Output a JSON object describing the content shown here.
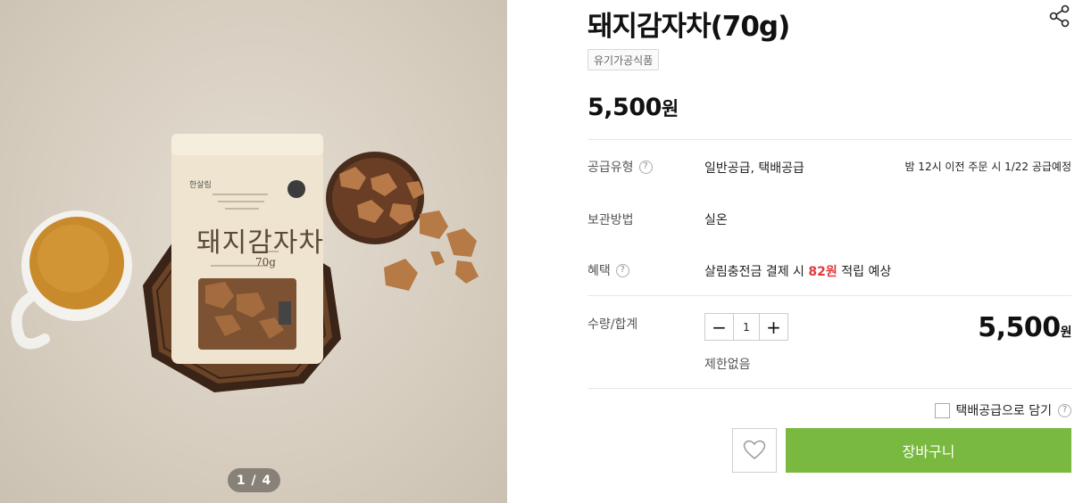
{
  "gallery": {
    "package_brand": "한살림",
    "package_title": "돼지감자차",
    "package_weight": "70g",
    "pager_current": "1",
    "pager_separator": "/",
    "pager_total": "4",
    "current_index": 1,
    "total_images": 4
  },
  "product": {
    "title": "돼지감자차(70g)",
    "tag": "유기가공식품",
    "price_amount": "5,500",
    "price_unit": "원"
  },
  "details": {
    "supply_type_label": "공급유형",
    "supply_type_value": "일반공급, 택배공급",
    "supply_note": "밤 12시 이전 주문 시 1/22 공급예정",
    "storage_label": "보관방법",
    "storage_value": "실온",
    "benefit_label": "혜택",
    "benefit_prefix": "살림충전금 결제 시",
    "benefit_points": "82원",
    "benefit_suffix": "적립 예상",
    "help_symbol": "?"
  },
  "order": {
    "quantity_label": "수량/합계",
    "minus_symbol": "−",
    "plus_symbol": "+",
    "quantity": "1",
    "limit_text": "제한없음",
    "total_amount": "5,500",
    "total_unit": "원"
  },
  "actions": {
    "courier_label": "택배공급으로 담기",
    "courier_checked": false,
    "cart_label": "장바구니"
  },
  "colors": {
    "accent_green": "#7ab940",
    "points_red": "#e0393e"
  },
  "icons": [
    "share-icon",
    "help-icon",
    "heart-icon",
    "minus-icon",
    "plus-icon"
  ]
}
